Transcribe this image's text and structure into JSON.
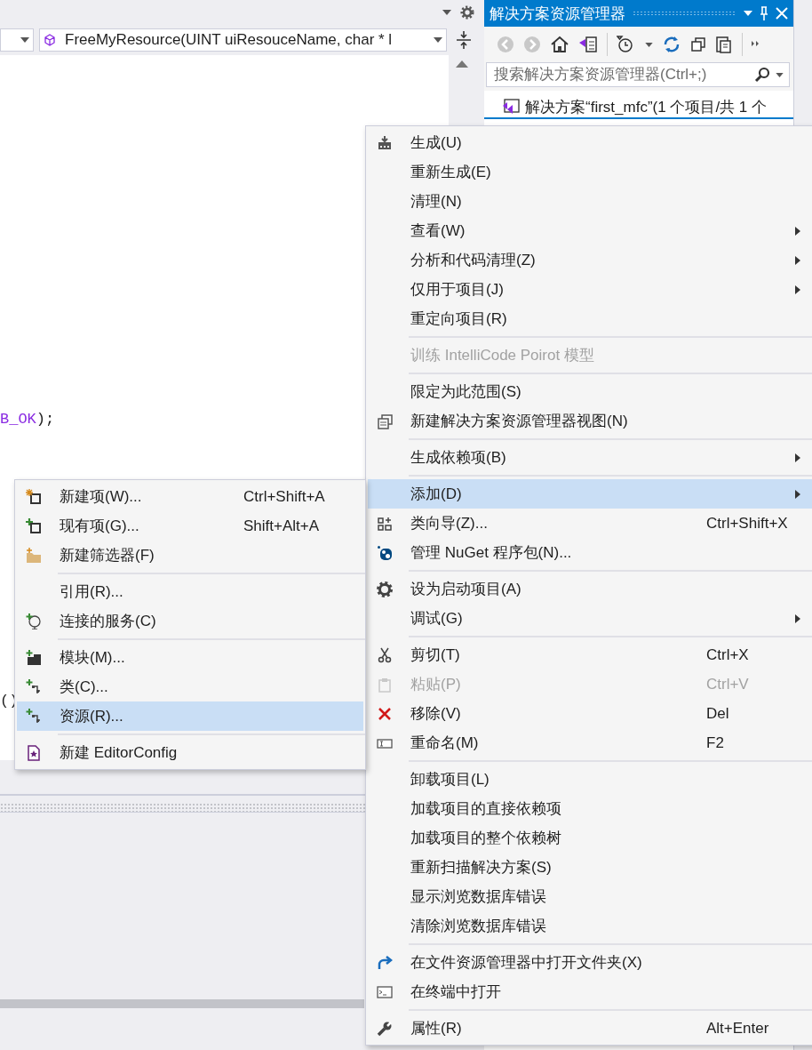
{
  "editor": {
    "member_field": "FreeMyResource(UINT uiResouceName, char * l",
    "code_lines": [
      {
        "segments": [
          {
            "text": "B_OK",
            "kind": "macro"
          },
          {
            "text": ");",
            "kind": "plain"
          }
        ]
      },
      {
        "segments": [
          {
            "text": "()",
            "kind": "plain"
          }
        ]
      }
    ]
  },
  "solution_explorer": {
    "title": "解决方案资源管理器",
    "search": {
      "placeholder": "搜索解决方案资源管理器(Ctrl+;)"
    },
    "tree": [
      {
        "label": "解决方案“first_mfc”(1 个项目/共 1 个"
      }
    ]
  },
  "context_menu": {
    "items": [
      {
        "kind": "item",
        "label": "生成(U)",
        "submenu": false,
        "disabled": false,
        "selected": false
      },
      {
        "kind": "item",
        "label": "重新生成(E)",
        "submenu": false,
        "disabled": false,
        "selected": false
      },
      {
        "kind": "item",
        "label": "清理(N)",
        "submenu": false,
        "disabled": false,
        "selected": false
      },
      {
        "kind": "item",
        "label": "查看(W)",
        "submenu": true,
        "disabled": false,
        "selected": false
      },
      {
        "kind": "item",
        "label": "分析和代码清理(Z)",
        "submenu": true,
        "disabled": false,
        "selected": false
      },
      {
        "kind": "item",
        "label": "仅用于项目(J)",
        "submenu": true,
        "disabled": false,
        "selected": false
      },
      {
        "kind": "item",
        "label": "重定向项目(R)",
        "submenu": false,
        "disabled": false,
        "selected": false
      },
      {
        "kind": "separator"
      },
      {
        "kind": "item",
        "label": "训练 IntelliCode Poirot 模型",
        "submenu": false,
        "disabled": true,
        "selected": false
      },
      {
        "kind": "separator"
      },
      {
        "kind": "item",
        "label": "限定为此范围(S)",
        "submenu": false,
        "disabled": false,
        "selected": false
      },
      {
        "kind": "item",
        "label": "新建解决方案资源管理器视图(N)",
        "submenu": false,
        "disabled": false,
        "selected": false
      },
      {
        "kind": "separator"
      },
      {
        "kind": "item",
        "label": "生成依赖项(B)",
        "submenu": true,
        "disabled": false,
        "selected": false
      },
      {
        "kind": "separator"
      },
      {
        "kind": "item",
        "label": "添加(D)",
        "submenu": true,
        "disabled": false,
        "selected": true
      },
      {
        "kind": "item",
        "label": "类向导(Z)...",
        "shortcut": "Ctrl+Shift+X",
        "submenu": false,
        "disabled": false,
        "selected": false
      },
      {
        "kind": "item",
        "label": "管理 NuGet 程序包(N)...",
        "submenu": false,
        "disabled": false,
        "selected": false
      },
      {
        "kind": "separator"
      },
      {
        "kind": "item",
        "label": "设为启动项目(A)",
        "submenu": false,
        "disabled": false,
        "selected": false
      },
      {
        "kind": "item",
        "label": "调试(G)",
        "submenu": true,
        "disabled": false,
        "selected": false
      },
      {
        "kind": "separator"
      },
      {
        "kind": "item",
        "label": "剪切(T)",
        "shortcut": "Ctrl+X",
        "submenu": false,
        "disabled": false,
        "selected": false
      },
      {
        "kind": "item",
        "label": "粘贴(P)",
        "shortcut": "Ctrl+V",
        "submenu": false,
        "disabled": true,
        "selected": false
      },
      {
        "kind": "item",
        "label": "移除(V)",
        "shortcut": "Del",
        "submenu": false,
        "disabled": false,
        "selected": false
      },
      {
        "kind": "item",
        "label": "重命名(M)",
        "shortcut": "F2",
        "submenu": false,
        "disabled": false,
        "selected": false
      },
      {
        "kind": "separator"
      },
      {
        "kind": "item",
        "label": "卸载项目(L)",
        "submenu": false,
        "disabled": false,
        "selected": false
      },
      {
        "kind": "item",
        "label": "加载项目的直接依赖项",
        "submenu": false,
        "disabled": false,
        "selected": false
      },
      {
        "kind": "item",
        "label": "加载项目的整个依赖树",
        "submenu": false,
        "disabled": false,
        "selected": false
      },
      {
        "kind": "item",
        "label": "重新扫描解决方案(S)",
        "submenu": false,
        "disabled": false,
        "selected": false
      },
      {
        "kind": "item",
        "label": "显示浏览数据库错误",
        "submenu": false,
        "disabled": false,
        "selected": false
      },
      {
        "kind": "item",
        "label": "清除浏览数据库错误",
        "submenu": false,
        "disabled": false,
        "selected": false
      },
      {
        "kind": "separator"
      },
      {
        "kind": "item",
        "label": "在文件资源管理器中打开文件夹(X)",
        "submenu": false,
        "disabled": false,
        "selected": false
      },
      {
        "kind": "item",
        "label": "在终端中打开",
        "submenu": false,
        "disabled": false,
        "selected": false
      },
      {
        "kind": "separator"
      },
      {
        "kind": "item",
        "label": "属性(R)",
        "shortcut": "Alt+Enter",
        "submenu": false,
        "disabled": false,
        "selected": false
      }
    ]
  },
  "add_submenu": {
    "items": [
      {
        "kind": "item",
        "label": "新建项(W)...",
        "shortcut": "Ctrl+Shift+A",
        "selected": false
      },
      {
        "kind": "item",
        "label": "现有项(G)...",
        "shortcut": "Shift+Alt+A",
        "selected": false
      },
      {
        "kind": "item",
        "label": "新建筛选器(F)",
        "selected": false
      },
      {
        "kind": "separator"
      },
      {
        "kind": "item",
        "label": "引用(R)...",
        "selected": false
      },
      {
        "kind": "item",
        "label": "连接的服务(C)",
        "selected": false
      },
      {
        "kind": "separator"
      },
      {
        "kind": "item",
        "label": "模块(M)...",
        "selected": false
      },
      {
        "kind": "item",
        "label": "类(C)...",
        "selected": false
      },
      {
        "kind": "item",
        "label": "资源(R)...",
        "selected": true
      },
      {
        "kind": "separator"
      },
      {
        "kind": "item",
        "label": "新建 EditorConfig",
        "selected": false
      }
    ]
  }
}
